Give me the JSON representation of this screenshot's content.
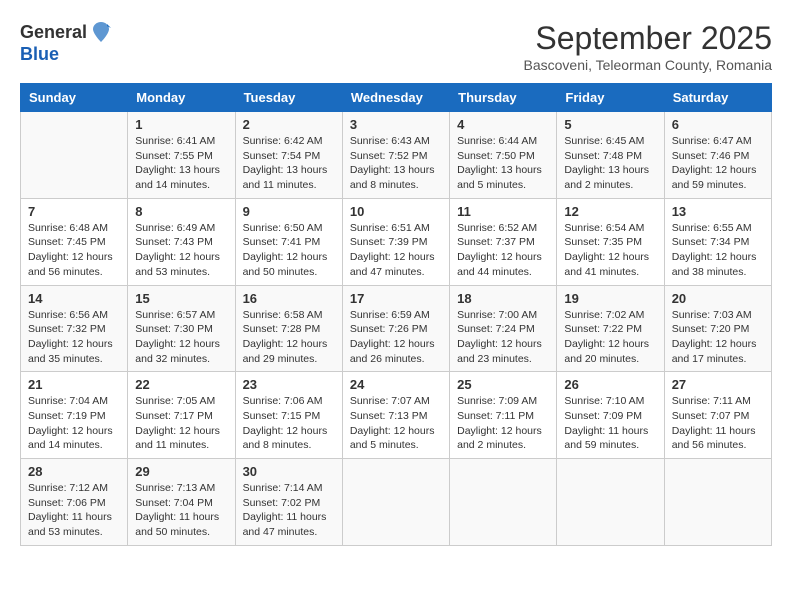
{
  "header": {
    "logo_general": "General",
    "logo_blue": "Blue",
    "month_title": "September 2025",
    "subtitle": "Bascoveni, Teleorman County, Romania"
  },
  "columns": [
    "Sunday",
    "Monday",
    "Tuesday",
    "Wednesday",
    "Thursday",
    "Friday",
    "Saturday"
  ],
  "weeks": [
    [
      {
        "day": "",
        "info": ""
      },
      {
        "day": "1",
        "info": "Sunrise: 6:41 AM\nSunset: 7:55 PM\nDaylight: 13 hours\nand 14 minutes."
      },
      {
        "day": "2",
        "info": "Sunrise: 6:42 AM\nSunset: 7:54 PM\nDaylight: 13 hours\nand 11 minutes."
      },
      {
        "day": "3",
        "info": "Sunrise: 6:43 AM\nSunset: 7:52 PM\nDaylight: 13 hours\nand 8 minutes."
      },
      {
        "day": "4",
        "info": "Sunrise: 6:44 AM\nSunset: 7:50 PM\nDaylight: 13 hours\nand 5 minutes."
      },
      {
        "day": "5",
        "info": "Sunrise: 6:45 AM\nSunset: 7:48 PM\nDaylight: 13 hours\nand 2 minutes."
      },
      {
        "day": "6",
        "info": "Sunrise: 6:47 AM\nSunset: 7:46 PM\nDaylight: 12 hours\nand 59 minutes."
      }
    ],
    [
      {
        "day": "7",
        "info": "Sunrise: 6:48 AM\nSunset: 7:45 PM\nDaylight: 12 hours\nand 56 minutes."
      },
      {
        "day": "8",
        "info": "Sunrise: 6:49 AM\nSunset: 7:43 PM\nDaylight: 12 hours\nand 53 minutes."
      },
      {
        "day": "9",
        "info": "Sunrise: 6:50 AM\nSunset: 7:41 PM\nDaylight: 12 hours\nand 50 minutes."
      },
      {
        "day": "10",
        "info": "Sunrise: 6:51 AM\nSunset: 7:39 PM\nDaylight: 12 hours\nand 47 minutes."
      },
      {
        "day": "11",
        "info": "Sunrise: 6:52 AM\nSunset: 7:37 PM\nDaylight: 12 hours\nand 44 minutes."
      },
      {
        "day": "12",
        "info": "Sunrise: 6:54 AM\nSunset: 7:35 PM\nDaylight: 12 hours\nand 41 minutes."
      },
      {
        "day": "13",
        "info": "Sunrise: 6:55 AM\nSunset: 7:34 PM\nDaylight: 12 hours\nand 38 minutes."
      }
    ],
    [
      {
        "day": "14",
        "info": "Sunrise: 6:56 AM\nSunset: 7:32 PM\nDaylight: 12 hours\nand 35 minutes."
      },
      {
        "day": "15",
        "info": "Sunrise: 6:57 AM\nSunset: 7:30 PM\nDaylight: 12 hours\nand 32 minutes."
      },
      {
        "day": "16",
        "info": "Sunrise: 6:58 AM\nSunset: 7:28 PM\nDaylight: 12 hours\nand 29 minutes."
      },
      {
        "day": "17",
        "info": "Sunrise: 6:59 AM\nSunset: 7:26 PM\nDaylight: 12 hours\nand 26 minutes."
      },
      {
        "day": "18",
        "info": "Sunrise: 7:00 AM\nSunset: 7:24 PM\nDaylight: 12 hours\nand 23 minutes."
      },
      {
        "day": "19",
        "info": "Sunrise: 7:02 AM\nSunset: 7:22 PM\nDaylight: 12 hours\nand 20 minutes."
      },
      {
        "day": "20",
        "info": "Sunrise: 7:03 AM\nSunset: 7:20 PM\nDaylight: 12 hours\nand 17 minutes."
      }
    ],
    [
      {
        "day": "21",
        "info": "Sunrise: 7:04 AM\nSunset: 7:19 PM\nDaylight: 12 hours\nand 14 minutes."
      },
      {
        "day": "22",
        "info": "Sunrise: 7:05 AM\nSunset: 7:17 PM\nDaylight: 12 hours\nand 11 minutes."
      },
      {
        "day": "23",
        "info": "Sunrise: 7:06 AM\nSunset: 7:15 PM\nDaylight: 12 hours\nand 8 minutes."
      },
      {
        "day": "24",
        "info": "Sunrise: 7:07 AM\nSunset: 7:13 PM\nDaylight: 12 hours\nand 5 minutes."
      },
      {
        "day": "25",
        "info": "Sunrise: 7:09 AM\nSunset: 7:11 PM\nDaylight: 12 hours\nand 2 minutes."
      },
      {
        "day": "26",
        "info": "Sunrise: 7:10 AM\nSunset: 7:09 PM\nDaylight: 11 hours\nand 59 minutes."
      },
      {
        "day": "27",
        "info": "Sunrise: 7:11 AM\nSunset: 7:07 PM\nDaylight: 11 hours\nand 56 minutes."
      }
    ],
    [
      {
        "day": "28",
        "info": "Sunrise: 7:12 AM\nSunset: 7:06 PM\nDaylight: 11 hours\nand 53 minutes."
      },
      {
        "day": "29",
        "info": "Sunrise: 7:13 AM\nSunset: 7:04 PM\nDaylight: 11 hours\nand 50 minutes."
      },
      {
        "day": "30",
        "info": "Sunrise: 7:14 AM\nSunset: 7:02 PM\nDaylight: 11 hours\nand 47 minutes."
      },
      {
        "day": "",
        "info": ""
      },
      {
        "day": "",
        "info": ""
      },
      {
        "day": "",
        "info": ""
      },
      {
        "day": "",
        "info": ""
      }
    ]
  ]
}
